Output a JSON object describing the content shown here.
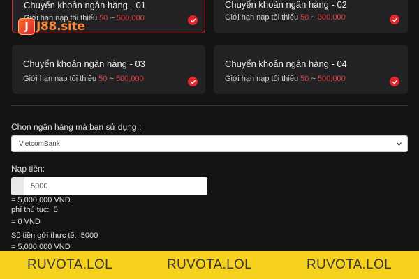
{
  "brand": {
    "logo_letter": "J",
    "logo_text": "J88.site"
  },
  "cards": [
    {
      "title": "Chuyển khoản ngân hàng - 01",
      "limit_prefix": "Giới hạn nạp tối thiểu",
      "min": "50",
      "sep": "~",
      "max": "500,000",
      "selected": true
    },
    {
      "title": "Chuyển khoản ngân hàng - 02",
      "limit_prefix": "Giới hạn nạp tối thiểu",
      "min": "50",
      "sep": "~",
      "max": "300,000",
      "selected": false
    },
    {
      "title": "Chuyển khoản ngân hàng - 03",
      "limit_prefix": "Giới hạn nạp tối thiểu",
      "min": "50",
      "sep": "~",
      "max": "500,000",
      "selected": false
    },
    {
      "title": "Chuyển khoản ngân hàng - 04",
      "limit_prefix": "Giới hạn nạp tối thiểu",
      "min": "50",
      "sep": "~",
      "max": "500,000",
      "selected": false
    }
  ],
  "bank_select": {
    "label": "Chọn ngân hàng mà bạn sử dụng :",
    "value": "VietcomBank"
  },
  "deposit": {
    "label": "Nạp tiền:",
    "amount": "5000",
    "amount_vnd": "= 5,000,000 VND",
    "fee_label": "phí thủ tục:",
    "fee_value": "0",
    "fee_vnd": "= 0 VND",
    "actual_label": "Số tiền gửi thực tế:",
    "actual_value": "5000",
    "actual_vnd": "= 5,000,000 VND"
  },
  "banner": [
    "RUVOTA.LOL",
    "RUVOTA.LOL",
    "RUVOTA.LOL"
  ],
  "colors": {
    "accent": "#e3262e",
    "banner": "#f6d21e",
    "background": "#141414",
    "card": "#222225"
  }
}
